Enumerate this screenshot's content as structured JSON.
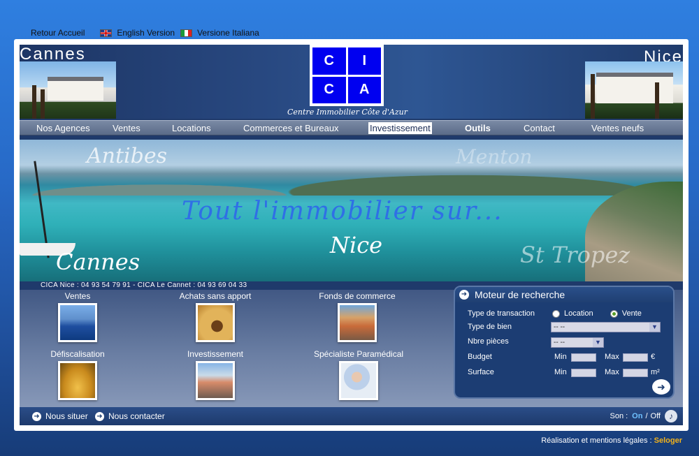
{
  "toplinks": {
    "home": "Retour Accueil",
    "english": "English Version",
    "italian": "Versione Italiana"
  },
  "header": {
    "city_left": "Cannes",
    "city_right": "Nice",
    "logo": [
      "C",
      "I",
      "C",
      "A"
    ],
    "tagline": "Centre Immobilier Côte d'Azur"
  },
  "nav": [
    {
      "label": "Nos Agences"
    },
    {
      "label": "Ventes"
    },
    {
      "label": "Locations"
    },
    {
      "label": "Commerces et Bureaux"
    },
    {
      "label": "Investissement"
    },
    {
      "label": "Outils"
    },
    {
      "label": "Contact"
    },
    {
      "label": "Ventes neufs"
    }
  ],
  "banner": {
    "antibes": "Antibes",
    "menton": "Menton",
    "headline": "Tout l'immobilier sur...",
    "nice": "Nice",
    "cannes": "Cannes",
    "tropez": "St Tropez"
  },
  "phones": "CICA Nice : 04 93 54 79 91 - CICA Le Cannet : 04 93 69 04 33",
  "tiles": [
    {
      "label": "Ventes"
    },
    {
      "label": "Achats sans apport"
    },
    {
      "label": "Fonds de commerce"
    },
    {
      "label": "Défiscalisation"
    },
    {
      "label": "Investissement"
    },
    {
      "label": "Spécialiste Paramédical"
    }
  ],
  "search": {
    "title": "Moteur de recherche",
    "transaction_label": "Type de transaction",
    "location": "Location",
    "vente": "Vente",
    "bien_label": "Type de bien",
    "bien_value": "-- --",
    "pieces_label": "Nbre pièces",
    "pieces_value": "-- --",
    "budget_label": "Budget",
    "surface_label": "Surface",
    "min": "Min",
    "max": "Max",
    "euro": "€",
    "m2": "m²"
  },
  "footer": {
    "situer": "Nous situer",
    "contacter": "Nous contacter",
    "son": "Son :",
    "on": "On",
    "sep": "/",
    "off": "Off"
  },
  "credits": {
    "text": "Réalisation et mentions légales :",
    "brand": "Seloger"
  }
}
